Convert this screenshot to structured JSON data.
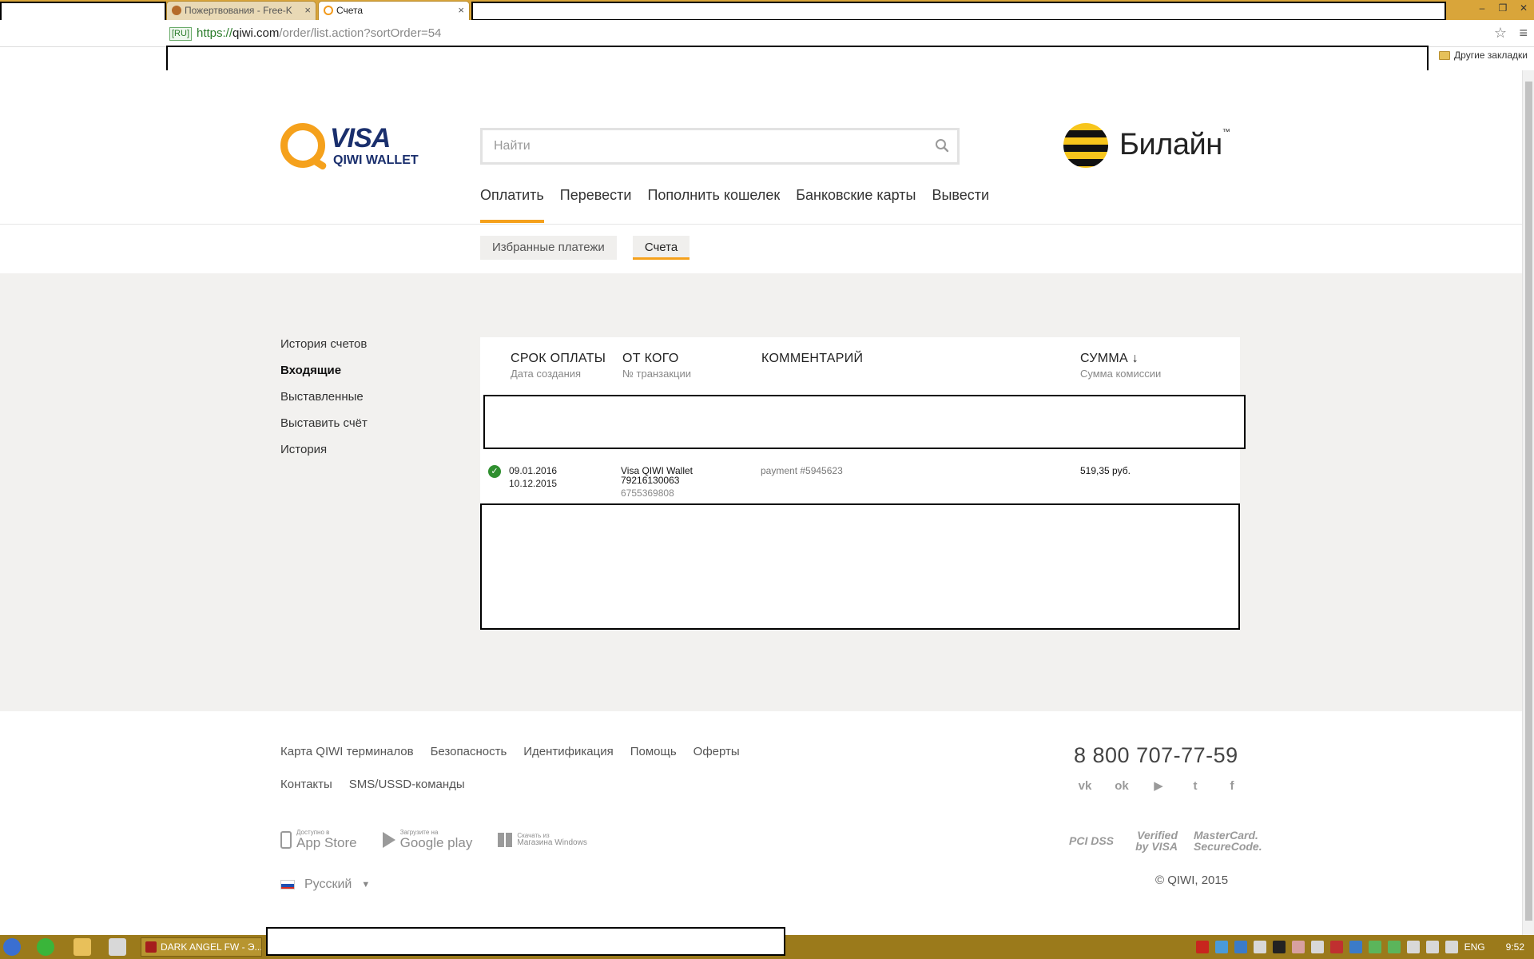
{
  "browser": {
    "tabs": [
      {
        "label": "Пожертвования - Free-K"
      },
      {
        "label": "Счета"
      }
    ],
    "url": {
      "badge": "[RU]",
      "scheme": "https://",
      "host": "qiwi.com",
      "path": "/order/list.action?sortOrder=54"
    },
    "bookmarks": {
      "other_label": "Другие закладки"
    }
  },
  "header": {
    "logo": {
      "visa": "VISA",
      "wallet": "QIWI WALLET"
    },
    "search": {
      "placeholder": "Найти"
    },
    "partner": {
      "name": "Билайн",
      "tm": "™"
    },
    "nav": [
      {
        "label": "Оплатить",
        "active": true
      },
      {
        "label": "Перевести"
      },
      {
        "label": "Пополнить кошелек"
      },
      {
        "label": "Банковские карты"
      },
      {
        "label": "Вывести"
      }
    ],
    "subnav": [
      {
        "label": "Избранные платежи"
      },
      {
        "label": "Счета",
        "active": true
      }
    ]
  },
  "sidebar": {
    "items": [
      {
        "label": "История счетов"
      },
      {
        "label": "Входящие",
        "active": true
      },
      {
        "label": "Выставленные"
      },
      {
        "label": "Выставить счёт"
      },
      {
        "label": "История"
      }
    ]
  },
  "table": {
    "columns": {
      "due": {
        "title": "СРОК ОПЛАТЫ",
        "sub": "Дата создания"
      },
      "from": {
        "title": "ОТ КОГО",
        "sub": "№ транзакции"
      },
      "comment": {
        "title": "КОММЕНТАРИЙ"
      },
      "sum": {
        "title": "СУММА ↓",
        "sub": "Сумма комиссии"
      }
    },
    "rows": [
      {
        "status": "paid",
        "due_date": "09.01.2016",
        "created_date": "10.12.2015",
        "from_name": "Visa QIWI Wallet",
        "from_phone": "79216130063",
        "transaction": "6755369808",
        "comment": "payment #5945623",
        "sum": "519,35 руб."
      }
    ]
  },
  "footer": {
    "links_row1": [
      "Карта QIWI терминалов",
      "Безопасность",
      "Идентификация",
      "Помощь",
      "Оферты"
    ],
    "links_row2": [
      "Контакты",
      "SMS/USSD-команды"
    ],
    "phone": "8 800 707-77-59",
    "socials": [
      "vk-icon",
      "odnoklassniki-icon",
      "youtube-icon",
      "twitter-icon",
      "facebook-icon"
    ],
    "stores": {
      "appstore": {
        "small": "Доступно в",
        "big": "App Store"
      },
      "googleplay": {
        "small": "Загрузите на",
        "big": "Google play"
      },
      "windows": {
        "small": "Скачать из",
        "big": "Магазина Windows"
      }
    },
    "certs": {
      "pci": "PCI DSS",
      "verified": "Verified by VISA",
      "mastercard": "MasterCard. SecureCode."
    },
    "language": "Русский",
    "copyright": "© QIWI, 2015"
  },
  "taskbar": {
    "app_label": "DARK ANGEL FW - Э...",
    "lang": "ENG",
    "time": "9:52"
  },
  "colors": {
    "accent": "#f5a11c",
    "taskbar": "#9b7a1b",
    "page_gray": "#f2f1ef",
    "paid_status": "#2f8f2f"
  }
}
